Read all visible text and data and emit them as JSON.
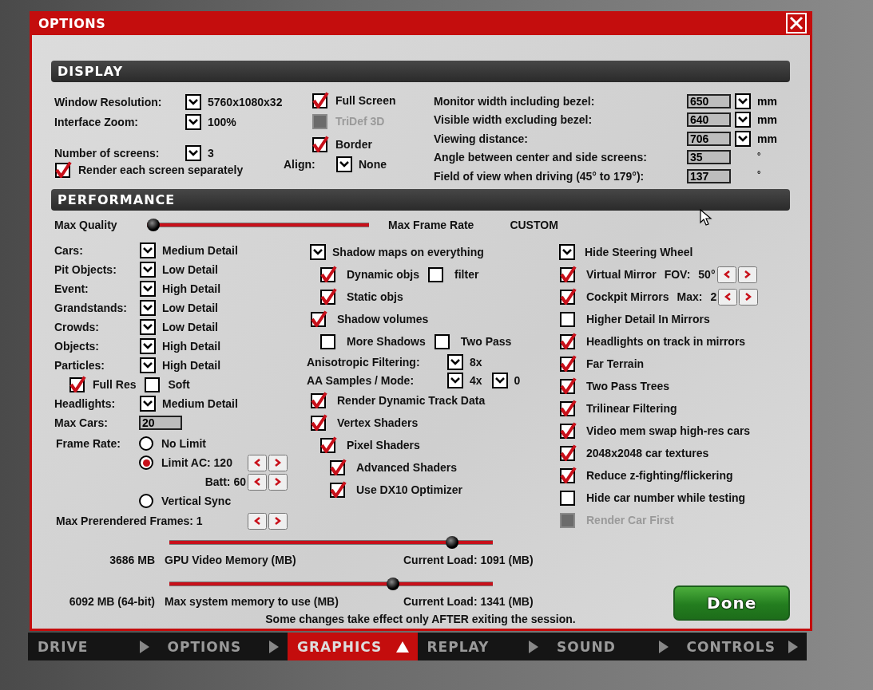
{
  "window": {
    "title": "OPTIONS"
  },
  "display": {
    "title": "DISPLAY",
    "selects": [
      {
        "label": "Window Resolution:",
        "value": "5760x1080x32"
      },
      {
        "label": "Interface Zoom:",
        "value": "100%"
      },
      {
        "label": "Number of screens:",
        "value": "3"
      }
    ],
    "render_separately": {
      "label": "Render each screen separately",
      "checked": true
    },
    "checks": [
      {
        "label": "Full Screen",
        "checked": true,
        "disabled": false
      },
      {
        "label": "TriDef 3D",
        "checked": false,
        "disabled": true
      },
      {
        "label": "Border",
        "checked": true,
        "disabled": false
      }
    ],
    "align": {
      "label": "Align:",
      "value": "None"
    },
    "measures": [
      {
        "label": "Monitor width including bezel:",
        "value": "650",
        "dropdown": true,
        "unit": "mm"
      },
      {
        "label": "Visible width excluding bezel:",
        "value": "640",
        "dropdown": true,
        "unit": "mm"
      },
      {
        "label": "Viewing distance:",
        "value": "706",
        "dropdown": true,
        "unit": "mm"
      },
      {
        "label": "Angle between center and side screens:",
        "value": "35",
        "dropdown": false,
        "unit": "°"
      },
      {
        "label": "Field of view when driving (45° to 179°):",
        "value": "137",
        "dropdown": false,
        "unit": "°"
      }
    ]
  },
  "performance": {
    "title": "PERFORMANCE",
    "max_quality": {
      "label": "Max Quality",
      "level": 0
    },
    "max_frame_rate": "Max Frame Rate",
    "preset": "CUSTOM",
    "details": [
      {
        "label": "Cars:",
        "value": "Medium Detail"
      },
      {
        "label": "Pit Objects:",
        "value": "Low Detail"
      },
      {
        "label": "Event:",
        "value": "High Detail"
      },
      {
        "label": "Grandstands:",
        "value": "Low Detail"
      },
      {
        "label": "Crowds:",
        "value": "Low Detail"
      },
      {
        "label": "Objects:",
        "value": "High Detail"
      },
      {
        "label": "Particles:",
        "value": "High Detail"
      }
    ],
    "particle_checks": [
      {
        "label": "Full Res",
        "checked": true
      },
      {
        "label": "Soft",
        "checked": false
      }
    ],
    "headlights": {
      "label": "Headlights:",
      "value": "Medium Detail"
    },
    "max_cars": {
      "label": "Max Cars:",
      "value": "20"
    },
    "frame_rate": {
      "label": "Frame Rate:",
      "options": [
        {
          "label": "No Limit",
          "selected": false,
          "stepper": false
        },
        {
          "label": "Limit AC: 120",
          "selected": true,
          "stepper": true,
          "sub": "Batt: 60"
        },
        {
          "label": "Vertical Sync",
          "selected": false,
          "stepper": false
        }
      ]
    },
    "prerendered": "Max Prerendered Frames: 1",
    "middle": [
      {
        "kind": "dropdown",
        "label": "Shadow maps on everything",
        "children": [
          {
            "kind": "checks",
            "items": [
              {
                "label": "Dynamic objs",
                "checked": true
              },
              {
                "label": "filter",
                "checked": false
              }
            ]
          },
          {
            "kind": "checks",
            "items": [
              {
                "label": "Static objs",
                "checked": true
              }
            ]
          }
        ]
      },
      {
        "kind": "checks",
        "items": [
          {
            "label": "Shadow volumes",
            "checked": true
          }
        ],
        "children": [
          {
            "kind": "checks",
            "items": [
              {
                "label": "More Shadows",
                "checked": false
              },
              {
                "label": "Two Pass",
                "checked": false
              }
            ]
          }
        ]
      },
      {
        "kind": "select",
        "label": "Anisotropic Filtering:",
        "values": [
          "8x"
        ]
      },
      {
        "kind": "select",
        "label": "AA Samples / Mode:",
        "values": [
          "4x",
          "0"
        ]
      },
      {
        "kind": "checks",
        "items": [
          {
            "label": "Render Dynamic Track Data",
            "checked": true
          }
        ]
      },
      {
        "kind": "checks",
        "items": [
          {
            "label": "Vertex Shaders",
            "checked": true
          }
        ],
        "children": [
          {
            "kind": "checks",
            "items": [
              {
                "label": "Pixel Shaders",
                "checked": true
              }
            ],
            "children": [
              {
                "kind": "checks",
                "items": [
                  {
                    "label": "Advanced Shaders",
                    "checked": true
                  }
                ]
              },
              {
                "kind": "checks",
                "items": [
                  {
                    "label": "Use DX10 Optimizer",
                    "checked": true
                  }
                ]
              }
            ]
          }
        ]
      }
    ],
    "right": [
      {
        "kind": "dropdown",
        "label": "Hide Steering Wheel"
      },
      {
        "kind": "check",
        "label": "Virtual Mirror",
        "checked": true,
        "disabled": false,
        "extra": {
          "label": "FOV:",
          "value": "50°"
        }
      },
      {
        "kind": "check",
        "label": "Cockpit Mirrors",
        "checked": true,
        "disabled": false,
        "extra": {
          "label": "Max:",
          "value": "2"
        }
      },
      {
        "kind": "check",
        "label": "Higher Detail In Mirrors",
        "checked": false,
        "disabled": false
      },
      {
        "kind": "check",
        "label": "Headlights on track in mirrors",
        "checked": true,
        "disabled": false
      },
      {
        "kind": "check",
        "label": "Far Terrain",
        "checked": true,
        "disabled": false
      },
      {
        "kind": "check",
        "label": "Two Pass Trees",
        "checked": true,
        "disabled": false
      },
      {
        "kind": "check",
        "label": "Trilinear Filtering",
        "checked": true,
        "disabled": false
      },
      {
        "kind": "check",
        "label": "Video mem swap high-res cars",
        "checked": true,
        "disabled": false
      },
      {
        "kind": "check",
        "label": "2048x2048 car textures",
        "checked": true,
        "disabled": false
      },
      {
        "kind": "check",
        "label": "Reduce z-fighting/flickering",
        "checked": true,
        "disabled": false
      },
      {
        "kind": "check",
        "label": "Hide car number while testing",
        "checked": false,
        "disabled": false
      },
      {
        "kind": "check",
        "label": "Render Car First",
        "checked": false,
        "disabled": true
      }
    ],
    "memory": [
      {
        "level": 0.89,
        "value": "3686 MB",
        "label": "GPU Video Memory (MB)",
        "load": "Current Load: 1091 (MB)"
      },
      {
        "level": 0.7,
        "value": "6092 MB (64-bit)",
        "label": "Max system memory to use (MB)",
        "load": "Current Load: 1341 (MB)"
      }
    ]
  },
  "notice": "Some changes take effect only AFTER exiting the session.",
  "done": "Done",
  "tabs": [
    {
      "label": "DRIVE",
      "selected": false
    },
    {
      "label": "OPTIONS",
      "selected": false
    },
    {
      "label": "GRAPHICS",
      "selected": true
    },
    {
      "label": "REPLAY",
      "selected": false
    },
    {
      "label": "SOUND",
      "selected": false
    },
    {
      "label": "CONTROLS",
      "selected": false
    }
  ]
}
